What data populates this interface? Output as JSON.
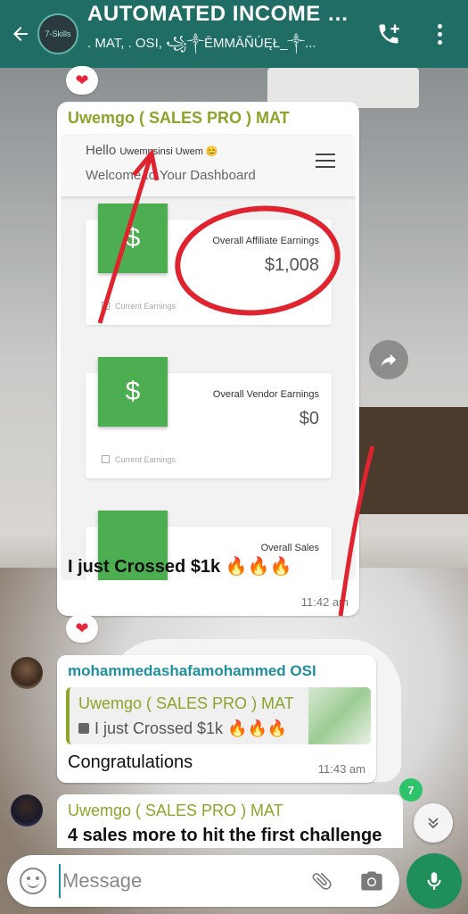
{
  "header": {
    "title": "AUTOMATED INCOME M...",
    "members": ". MAT, . OSI, ꧁༒ĒMMĀÑÚĘŁ_༒...",
    "avatar_text": "7-Skills"
  },
  "messages": [
    {
      "sender": "Uwemgo ( SALES PRO ) MAT",
      "reaction": "❤",
      "image": {
        "hello": "Hello",
        "user_name": "Uwemnsinsi Uwem 😊",
        "welcome": "Welcome to Your Dashboard",
        "cards": [
          {
            "label": "Overall Affiliate Earnings",
            "value": "$1,008",
            "footer": "Current Earnings"
          },
          {
            "label": "Overall Vendor Earnings",
            "value": "$0",
            "footer": "Current Earnings"
          },
          {
            "label": "Overall Sales",
            "value": "",
            "footer": ""
          }
        ]
      },
      "text": "I just Crossed $1k",
      "emoji": "🔥🔥🔥",
      "time": "11:42 am"
    },
    {
      "sender": "mohammedashafamohammed OSI",
      "reaction": "❤",
      "quote": {
        "sender": "Uwemgo ( SALES PRO ) MAT",
        "text": "I just Crossed $1k",
        "emoji": "🔥🔥🔥"
      },
      "text": "Congratulations",
      "time": "11:43 am"
    },
    {
      "sender": "Uwemgo ( SALES PRO ) MAT",
      "text": "4 sales more to hit the first challenge"
    }
  ],
  "unread_count": "7",
  "input": {
    "placeholder": "Message"
  },
  "icons": {
    "back": "arrow-left-icon",
    "add_call": "phone-plus-icon",
    "menu": "more-vertical-icon",
    "forward": "forward-icon",
    "scroll_down": "chevrons-down-icon",
    "emoji": "smiley-icon",
    "attach": "paperclip-icon",
    "camera": "camera-icon",
    "mic": "microphone-icon"
  },
  "colors": {
    "header": "#1f6d64",
    "sender_green": "#8aa52a",
    "sender_teal": "#1e8fa0",
    "dashboard_green": "#4cae50",
    "annotation_red": "#e0242f",
    "mic_button": "#1f8e5b",
    "unread_badge": "#2cc36a"
  }
}
